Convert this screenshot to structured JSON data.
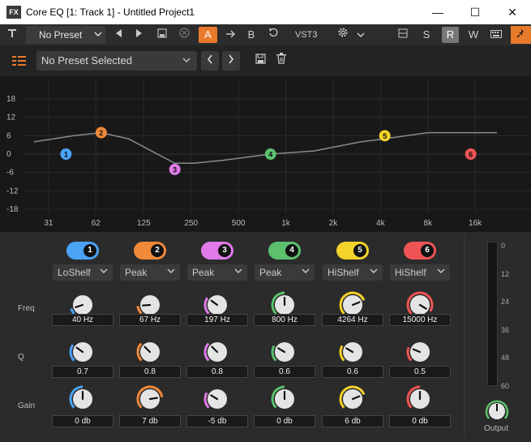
{
  "window": {
    "fx_badge": "FX",
    "title": "Core EQ [1: Track 1] - Untitled Project1",
    "minimize": "—",
    "maximize": "☐",
    "close": "✕"
  },
  "toolbar": {
    "preset_label": "No Preset",
    "a_label": "A",
    "b_label": "B",
    "format_label": "VST3",
    "s_label": "S",
    "r_label": "R",
    "w_label": "W"
  },
  "preset_bar": {
    "selected": "No Preset Selected"
  },
  "colors": {
    "accent": "#e87a2b",
    "band1": "#4aa3f5",
    "band2": "#f0893a",
    "band3": "#e07ae8",
    "band4": "#5cc06c",
    "band5": "#f3d22a",
    "band6": "#ef5454"
  },
  "graph": {
    "y_ticks": [
      "18",
      "12",
      "6",
      "0",
      "-6",
      "-12",
      "-18"
    ],
    "x_ticks": [
      "31",
      "62",
      "125",
      "250",
      "500",
      "1k",
      "2k",
      "4k",
      "8k",
      "16k"
    ],
    "nodes": [
      {
        "label": "1",
        "freq_hz": 40,
        "gain_db": 0
      },
      {
        "label": "2",
        "freq_hz": 67,
        "gain_db": 7
      },
      {
        "label": "3",
        "freq_hz": 197,
        "gain_db": -5
      },
      {
        "label": "4",
        "freq_hz": 800,
        "gain_db": 0
      },
      {
        "label": "5",
        "freq_hz": 4264,
        "gain_db": 6
      },
      {
        "label": "6",
        "freq_hz": 15000,
        "gain_db": 0
      }
    ]
  },
  "row_labels": {
    "freq": "Freq",
    "q": "Q",
    "gain": "Gain"
  },
  "bands": [
    {
      "num": "1",
      "type": "LoShelf",
      "freq": "40 Hz",
      "q": "0.7",
      "gain": "0 db",
      "freq_level": 0.1,
      "q_level": 0.3,
      "gain_level": 0.5
    },
    {
      "num": "2",
      "type": "Peak",
      "freq": "67 Hz",
      "q": "0.8",
      "gain": "7 db",
      "freq_level": 0.15,
      "q_level": 0.33,
      "gain_level": 0.8
    },
    {
      "num": "3",
      "type": "Peak",
      "freq": "197 Hz",
      "q": "0.8",
      "gain": "-5 db",
      "freq_level": 0.3,
      "q_level": 0.33,
      "gain_level": 0.28
    },
    {
      "num": "4",
      "type": "Peak",
      "freq": "800 Hz",
      "q": "0.6",
      "gain": "0 db",
      "freq_level": 0.5,
      "q_level": 0.28,
      "gain_level": 0.5
    },
    {
      "num": "5",
      "type": "HiShelf",
      "freq": "4264 Hz",
      "q": "0.6",
      "gain": "6 db",
      "freq_level": 0.75,
      "q_level": 0.28,
      "gain_level": 0.75
    },
    {
      "num": "6",
      "type": "HiShelf",
      "freq": "15000 Hz",
      "q": "0.5",
      "gain": "0 db",
      "freq_level": 0.95,
      "q_level": 0.25,
      "gain_level": 0.5
    }
  ],
  "output": {
    "label": "Output",
    "scale": [
      "0",
      "12",
      "24",
      "36",
      "48",
      "60"
    ]
  }
}
